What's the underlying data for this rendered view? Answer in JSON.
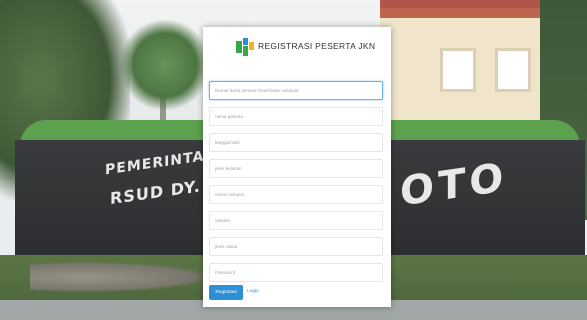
{
  "form": {
    "title": "REGISTRASI PESERTA JKN",
    "fields": [
      {
        "placeholder": "Nomor kartu jaminan kesehatan nasional"
      },
      {
        "placeholder": "nama peserta"
      },
      {
        "placeholder": "tanggal lahir"
      },
      {
        "placeholder": "jenis kelamin"
      },
      {
        "placeholder": "nomor telepon"
      },
      {
        "placeholder": "catatan"
      },
      {
        "placeholder": "jenis rawat"
      },
      {
        "placeholder": "Password"
      }
    ],
    "register_label": "Registrasi",
    "login_label": "Login"
  },
  "background": {
    "wall_line1": "PEMERINTAH KABUP",
    "wall_line2": "RSUD DY. M.M D",
    "wall_right": "OTO"
  },
  "colors": {
    "accent": "#2d8fd5",
    "active_field_border": "#68b4ea",
    "logo_green": "#3aa64a"
  }
}
